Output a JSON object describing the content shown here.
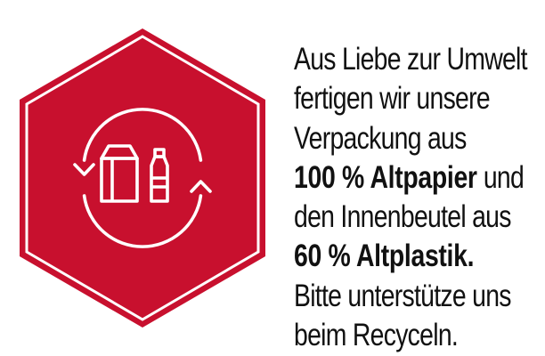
{
  "colors": {
    "badge_fill": "#c8102e",
    "badge_border": "#ffffff",
    "icon_stroke": "#ffffff",
    "text": "#111111",
    "background": "#ffffff"
  },
  "icons": {
    "badge": "hexagon-badge",
    "box": "paper-bag-icon",
    "bottle": "plastic-bottle-icon",
    "cycle": "recycle-arrows-icon"
  },
  "message": {
    "line1": "Aus Liebe zur Umwelt",
    "line2": "fertigen wir unsere",
    "line3": "Verpackung aus",
    "line4_bold": "100 % Altpapier",
    "line4_rest": " und",
    "line5": "den Innenbeutel aus",
    "line6_bold": "60 % Altplastik.",
    "line7": "Bitte unterstütze uns",
    "line8": "beim Recyceln."
  }
}
